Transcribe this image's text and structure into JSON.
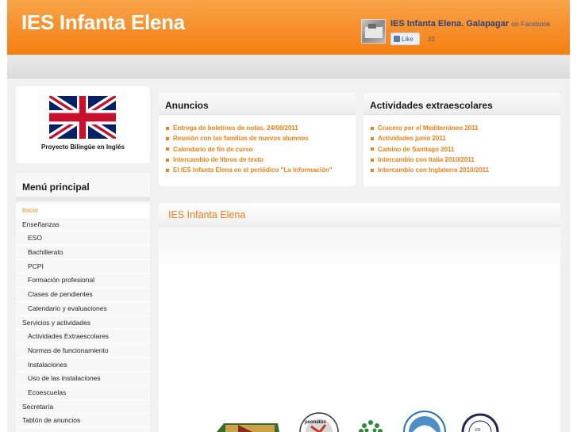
{
  "header": {
    "title": "IES Infanta Elena",
    "facebook": {
      "page_name": "IES Infanta Elena. Galapagar",
      "on_label": "on Facebook",
      "like_label": "Like",
      "like_count": "32"
    }
  },
  "sidebar": {
    "flag_caption": "Proyecto Bilingüe en Inglés",
    "menu_title": "Menú principal",
    "items": [
      {
        "label": "Inicio",
        "level": "top",
        "active": true
      },
      {
        "label": "Enseñanzas",
        "level": "top"
      },
      {
        "label": "ESO",
        "level": "sub"
      },
      {
        "label": "Bachillerato",
        "level": "sub"
      },
      {
        "label": "PCPI",
        "level": "sub"
      },
      {
        "label": "Formación profesional",
        "level": "sub"
      },
      {
        "label": "Clases de pendientes",
        "level": "sub"
      },
      {
        "label": "Calendario y evaluaciones",
        "level": "sub"
      },
      {
        "label": "Servicios y actividades",
        "level": "top"
      },
      {
        "label": "Actividades Extraescolares",
        "level": "sub"
      },
      {
        "label": "Normas de funcionamiento",
        "level": "sub"
      },
      {
        "label": "Instalaciones",
        "level": "sub"
      },
      {
        "label": "Uso de las instalaciones",
        "level": "sub"
      },
      {
        "label": "Ecoescuelas",
        "level": "sub"
      },
      {
        "label": "Secretaría",
        "level": "top"
      },
      {
        "label": "Tablón de anuncios",
        "level": "top"
      }
    ]
  },
  "anuncios": {
    "title": "Anuncios",
    "items": [
      "Entrega de boletines de notas. 24/06/2011",
      "Reunión con las familias de nuevos alumnos",
      "Calendario de fin de curso",
      "Intercambio de libros de texto",
      "El IES Infanta Elena en el periódico \"La Información\""
    ]
  },
  "actividades": {
    "title": "Actividades extraescolares",
    "items": [
      "Crucero por el Mediterráneo 2011",
      "Actividades junio 2011",
      "Camino de Santiago 2011",
      "Intercambio con Italia 2010/2011",
      "Intercambio con Inglaterra 2010/2011"
    ]
  },
  "main": {
    "title": "IES Infanta Elena"
  },
  "colors": {
    "accent": "#f47f12",
    "header_top": "#f9a54a",
    "facebook_blue": "#3b5998"
  }
}
